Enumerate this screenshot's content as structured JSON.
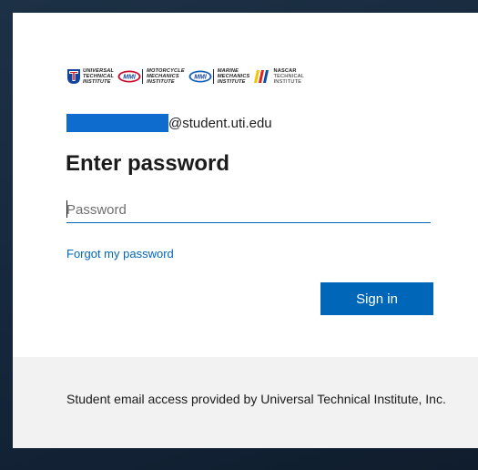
{
  "logos": {
    "uti": [
      "UNIVERSAL",
      "TECHNICAL",
      "INSTITUTE"
    ],
    "mmi_badge": "MMI",
    "motorcycle": [
      "MOTORCYCLE",
      "MECHANICS",
      "INSTITUTE"
    ],
    "marine": [
      "MARINE",
      "MECHANICS",
      "INSTITUTE"
    ],
    "nascar": [
      "NASCAR",
      "TECHNICAL",
      "INSTITUTE"
    ]
  },
  "account": {
    "email_suffix": "@student.uti.edu"
  },
  "title": "Enter password",
  "password": {
    "placeholder": "Password",
    "value": ""
  },
  "links": {
    "forgot": "Forgot my password"
  },
  "buttons": {
    "sign_in": "Sign in"
  },
  "footer": {
    "text": "Student email access provided by Universal Technical Institute, Inc."
  },
  "colors": {
    "accent": "#0067b8",
    "redaction": "#0d6ccd",
    "backdrop": "#1d3146",
    "footer_bg": "#f2f2f2"
  }
}
